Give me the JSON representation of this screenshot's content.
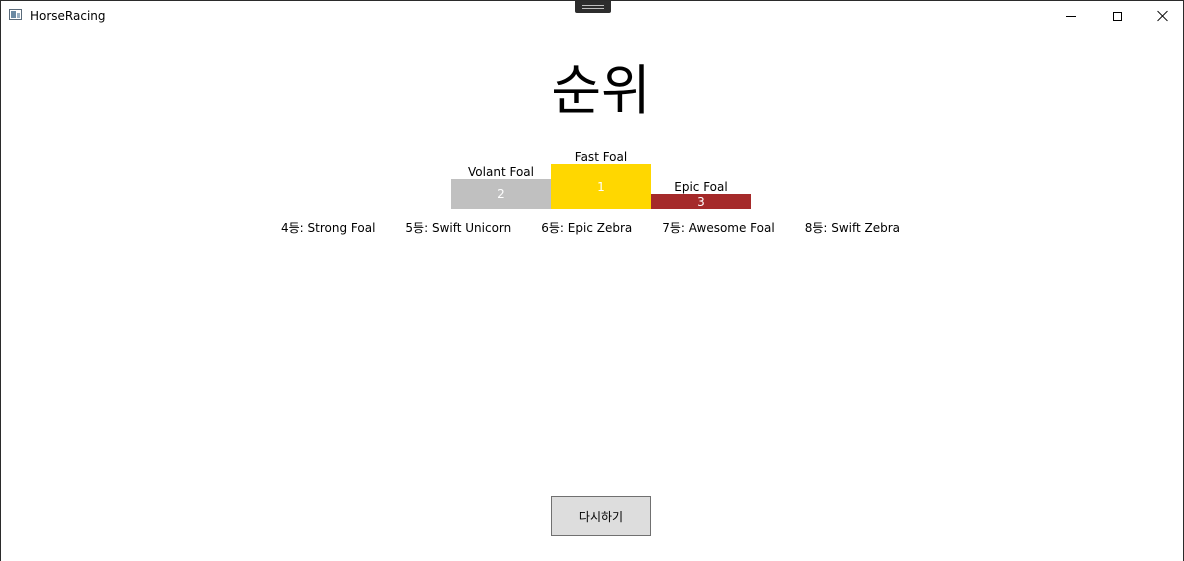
{
  "window": {
    "title": "HorseRacing"
  },
  "heading": "순위",
  "podium": {
    "first": {
      "name": "Fast Foal",
      "rank": "1",
      "color": "#FFD700"
    },
    "second": {
      "name": "Volant Foal",
      "rank": "2",
      "color": "#C0C0C0"
    },
    "third": {
      "name": "Epic Foal",
      "rank": "3",
      "color": "#A52A2A"
    }
  },
  "others": [
    "4등: Strong Foal",
    "5등: Swift Unicorn",
    "6등: Epic Zebra",
    "7등: Awesome Foal",
    "8등: Swift Zebra"
  ],
  "retry_button": {
    "label": "다시하기"
  },
  "icons": {
    "app": "app-icon",
    "minimize": "minimize-icon",
    "maximize": "maximize-icon",
    "close": "close-icon"
  }
}
